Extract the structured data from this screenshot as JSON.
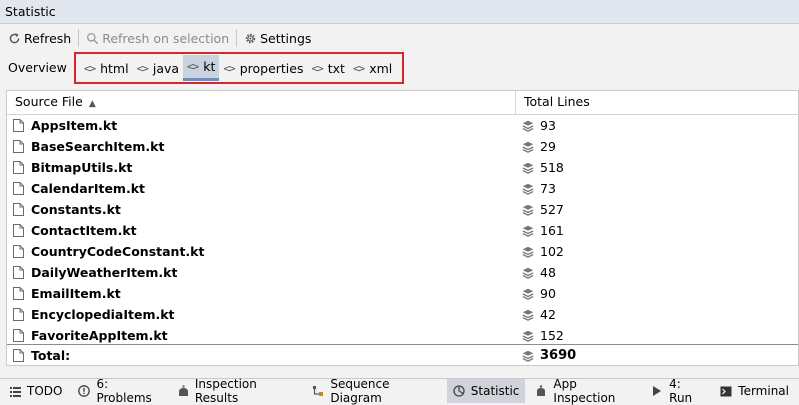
{
  "window": {
    "title": "Statistic"
  },
  "toolbar": {
    "refresh_label": "Refresh",
    "refresh_selection_label": "Refresh on selection",
    "settings_label": "Settings"
  },
  "tabs": {
    "overview_label": "Overview",
    "extensions": [
      {
        "label": "html",
        "active": false
      },
      {
        "label": "java",
        "active": false
      },
      {
        "label": "kt",
        "active": true
      },
      {
        "label": "properties",
        "active": false
      },
      {
        "label": "txt",
        "active": false
      },
      {
        "label": "xml",
        "active": false
      }
    ]
  },
  "table": {
    "columns": [
      "Source File",
      "Total Lines"
    ],
    "rows": [
      {
        "file": "AppsItem.kt",
        "lines": "93"
      },
      {
        "file": "BaseSearchItem.kt",
        "lines": "29"
      },
      {
        "file": "BitmapUtils.kt",
        "lines": "518"
      },
      {
        "file": "CalendarItem.kt",
        "lines": "73"
      },
      {
        "file": "Constants.kt",
        "lines": "527"
      },
      {
        "file": "ContactItem.kt",
        "lines": "161"
      },
      {
        "file": "CountryCodeConstant.kt",
        "lines": "102"
      },
      {
        "file": "DailyWeatherItem.kt",
        "lines": "48"
      },
      {
        "file": "EmailItem.kt",
        "lines": "90"
      },
      {
        "file": "EncyclopediaItem.kt",
        "lines": "42"
      },
      {
        "file": "FavoriteAppItem.kt",
        "lines": "152"
      }
    ],
    "total_label": "Total:",
    "total_value": "3690"
  },
  "bottombar": {
    "items": [
      {
        "label": "TODO",
        "icon": "list-icon",
        "active": false
      },
      {
        "label": "6: Problems",
        "icon": "problems-icon",
        "active": false
      },
      {
        "label": "Inspection Results",
        "icon": "inspection-icon",
        "active": false
      },
      {
        "label": "Sequence Diagram",
        "icon": "sequence-icon",
        "active": false
      },
      {
        "label": "Statistic",
        "icon": "pie-icon",
        "active": true
      },
      {
        "label": "App Inspection",
        "icon": "app-inspection-icon",
        "active": false
      },
      {
        "label": "4: Run",
        "icon": "run-icon",
        "active": false
      },
      {
        "label": "Terminal",
        "icon": "terminal-icon",
        "active": false
      }
    ]
  },
  "colors": {
    "tab_highlight": "#d7262e",
    "active_tab_bg": "#c9d2df",
    "active_bottom_bg": "#cfd3da"
  }
}
